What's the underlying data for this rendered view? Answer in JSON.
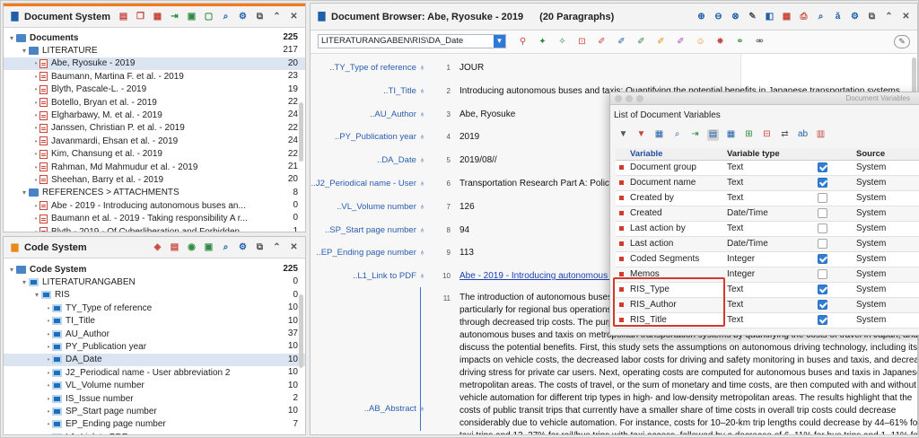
{
  "documents_panel": {
    "title": "Document System",
    "tree": [
      {
        "label": "Documents",
        "count": "225",
        "level": 0,
        "kind": "root"
      },
      {
        "label": "LITERATURE",
        "count": "217",
        "level": 1,
        "kind": "folder"
      },
      {
        "label": "Abe, Ryosuke - 2019",
        "count": "20",
        "level": 2,
        "kind": "doc",
        "selected": true
      },
      {
        "label": "Baumann, Martina F. et al. - 2019",
        "count": "23",
        "level": 2,
        "kind": "doc"
      },
      {
        "label": "Blyth, Pascale-L. - 2019",
        "count": "19",
        "level": 2,
        "kind": "doc"
      },
      {
        "label": "Botello, Bryan et al. - 2019",
        "count": "22",
        "level": 2,
        "kind": "doc"
      },
      {
        "label": "Elgharbawy, M. et al. - 2019",
        "count": "24",
        "level": 2,
        "kind": "doc"
      },
      {
        "label": "Janssen, Christian P. et al. - 2019",
        "count": "22",
        "level": 2,
        "kind": "doc"
      },
      {
        "label": "Javanmardi, Ehsan et al. - 2019",
        "count": "24",
        "level": 2,
        "kind": "doc"
      },
      {
        "label": "Kim, Chansung et al. - 2019",
        "count": "22",
        "level": 2,
        "kind": "doc"
      },
      {
        "label": "Rahman, Md Mahmudur et al. - 2019",
        "count": "21",
        "level": 2,
        "kind": "doc"
      },
      {
        "label": "Sheehan, Barry et al. - 2019",
        "count": "20",
        "level": 2,
        "kind": "doc"
      },
      {
        "label": "REFERENCES > ATTACHMENTS",
        "count": "8",
        "level": 1,
        "kind": "folder"
      },
      {
        "label": "Abe - 2019 - Introducing autonomous buses an...",
        "count": "0",
        "level": 2,
        "kind": "pdf"
      },
      {
        "label": "Baumann et al. - 2019 - Taking responsibility A r...",
        "count": "0",
        "level": 2,
        "kind": "pdf"
      },
      {
        "label": "Blyth - 2019 - Of Cyberliberation and Forbidden...",
        "count": "1",
        "level": 2,
        "kind": "pdf"
      }
    ]
  },
  "code_panel": {
    "title": "Code System",
    "tree": [
      {
        "label": "Code System",
        "count": "225",
        "level": 0,
        "kind": "root"
      },
      {
        "label": "LITERATURANGABEN",
        "count": "0",
        "level": 1,
        "kind": "code"
      },
      {
        "label": "RIS",
        "count": "0",
        "level": 2,
        "kind": "code"
      },
      {
        "label": "TY_Type of reference",
        "count": "10",
        "level": 3,
        "kind": "code"
      },
      {
        "label": "TI_Title",
        "count": "10",
        "level": 3,
        "kind": "code"
      },
      {
        "label": "AU_Author",
        "count": "37",
        "level": 3,
        "kind": "code"
      },
      {
        "label": "PY_Publication year",
        "count": "10",
        "level": 3,
        "kind": "code"
      },
      {
        "label": "DA_Date",
        "count": "10",
        "level": 3,
        "kind": "code",
        "selected": true
      },
      {
        "label": "J2_Periodical name - User abbreviation 2",
        "count": "10",
        "level": 3,
        "kind": "code"
      },
      {
        "label": "VL_Volume number",
        "count": "10",
        "level": 3,
        "kind": "code"
      },
      {
        "label": "IS_Issue number",
        "count": "2",
        "level": 3,
        "kind": "code"
      },
      {
        "label": "SP_Start page number",
        "count": "10",
        "level": 3,
        "kind": "code"
      },
      {
        "label": "EP_Ending page number",
        "count": "7",
        "level": 3,
        "kind": "code"
      },
      {
        "label": "L1_Link to PDF",
        "count": "",
        "level": 3,
        "kind": "code"
      }
    ]
  },
  "browser": {
    "title": "Document Browser: Abe, Ryosuke - 2019",
    "paragraphs": "(20 Paragraphs)",
    "code_selector": "LITERATURANGABEN\\RIS\\DA_Date",
    "segments": [
      {
        "code": "..TY_Type of reference",
        "line": "1",
        "text": "JOUR"
      },
      {
        "code": "..TI_Title",
        "line": "2",
        "text": "Introducing autonomous buses and taxis: Quantifying the potential benefits in Japanese transportation systems"
      },
      {
        "code": "..AU_Author",
        "line": "3",
        "text": "Abe, Ryosuke"
      },
      {
        "code": "..PY_Publication year",
        "line": "4",
        "text": "2019"
      },
      {
        "code": "..DA_Date",
        "line": "5",
        "text": "2019/08//"
      },
      {
        "code": "..J2_Periodical name - User",
        "line": "6",
        "text": "Transportation Research Part A: Policy an"
      },
      {
        "code": "..VL_Volume number",
        "line": "7",
        "text": "126"
      },
      {
        "code": "..SP_Start page number",
        "line": "8",
        "text": "94"
      },
      {
        "code": "..EP_Ending page number",
        "line": "9",
        "text": "113"
      },
      {
        "code": "..L1_Link to PDF",
        "line": "10",
        "text": "Abe - 2019 - Introducing autonomous bu"
      }
    ],
    "abstract_code": "..AB_Abstract",
    "abstract_line": "11",
    "abstract_lines": [
      "The introduction of autonomous buses a",
      "particularly for regional bus operations w",
      "through decreased trip costs. The purpo",
      "autonomous buses and taxis on metropolitan transportation systems by quantifying the costs of travel in Japan, and to",
      "discuss the potential benefits. First, this study sets the assumptions on autonomous driving technology, including its",
      "impacts on vehicle costs, the decreased labor costs for driving and safety monitoring in buses and taxis, and decreased",
      "driving stress for private car users. Next, operating costs are computed for autonomous buses and taxis in Japanese",
      "metropolitan areas. The costs of travel, or the sum of monetary and time costs, are then computed with and without",
      "vehicle automation for different trip types in high- and low-density metropolitan areas. The results highlight that the",
      "costs of public transit trips that currently have a smaller share of time costs in overall trip costs could decrease",
      "considerably due to vehicle automation. For instance, costs for 10–20-km trip lengths could decrease by 44–61% for",
      "taxi trips and 13–37% for rail/bus trips with taxi access, followed by a decrease of 6–11% for bus trips and 1–11% for"
    ]
  },
  "dialog": {
    "window_title": "Document Variables",
    "heading": "List of Document Variables",
    "columns": [
      "Variable",
      "Variable type",
      "",
      "Source"
    ],
    "rows": [
      {
        "name": "Document group",
        "type": "Text",
        "checked": true,
        "source": "System"
      },
      {
        "name": "Document name",
        "type": "Text",
        "checked": true,
        "source": "System"
      },
      {
        "name": "Created by",
        "type": "Text",
        "checked": false,
        "source": "System"
      },
      {
        "name": "Created",
        "type": "Date/Time",
        "checked": false,
        "source": "System"
      },
      {
        "name": "Last action by",
        "type": "Text",
        "checked": false,
        "source": "System"
      },
      {
        "name": "Last action",
        "type": "Date/Time",
        "checked": false,
        "source": "System"
      },
      {
        "name": "Coded Segments",
        "type": "Integer",
        "checked": true,
        "source": "System"
      },
      {
        "name": "Memos",
        "type": "Integer",
        "checked": false,
        "source": "System"
      },
      {
        "name": "RIS_Type",
        "type": "Text",
        "checked": true,
        "source": "System"
      },
      {
        "name": "RIS_Author",
        "type": "Text",
        "checked": true,
        "source": "System"
      },
      {
        "name": "RIS_Title",
        "type": "Text",
        "checked": true,
        "source": "System"
      }
    ]
  },
  "colors": {
    "accent": "#f07a1c",
    "highlight": "#d23b2b",
    "selection": "#dbe5f1",
    "link": "#1a3db0"
  }
}
